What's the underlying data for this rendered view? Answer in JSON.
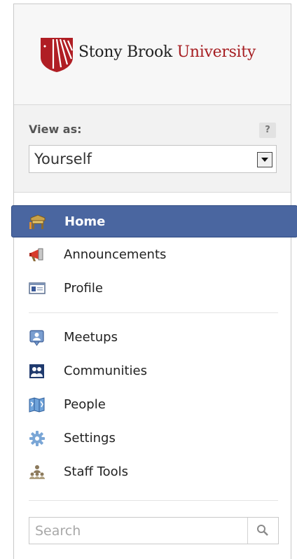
{
  "logo": {
    "primary": "Stony Brook",
    "secondary": "University"
  },
  "view_as": {
    "label": "View as:",
    "help": "?",
    "selected": "Yourself"
  },
  "nav": {
    "primary": [
      {
        "label": "Home",
        "icon": "home-icon",
        "active": true
      },
      {
        "label": "Announcements",
        "icon": "megaphone-icon",
        "active": false
      },
      {
        "label": "Profile",
        "icon": "profile-card-icon",
        "active": false
      }
    ],
    "secondary": [
      {
        "label": "Meetups",
        "icon": "meetups-icon"
      },
      {
        "label": "Communities",
        "icon": "communities-icon"
      },
      {
        "label": "People",
        "icon": "people-icon"
      },
      {
        "label": "Settings",
        "icon": "gear-icon"
      },
      {
        "label": "Staff Tools",
        "icon": "staff-tools-icon"
      }
    ]
  },
  "search": {
    "placeholder": "Search",
    "value": ""
  },
  "colors": {
    "active_bg": "#4a66a0",
    "brand_red": "#a61e22"
  }
}
